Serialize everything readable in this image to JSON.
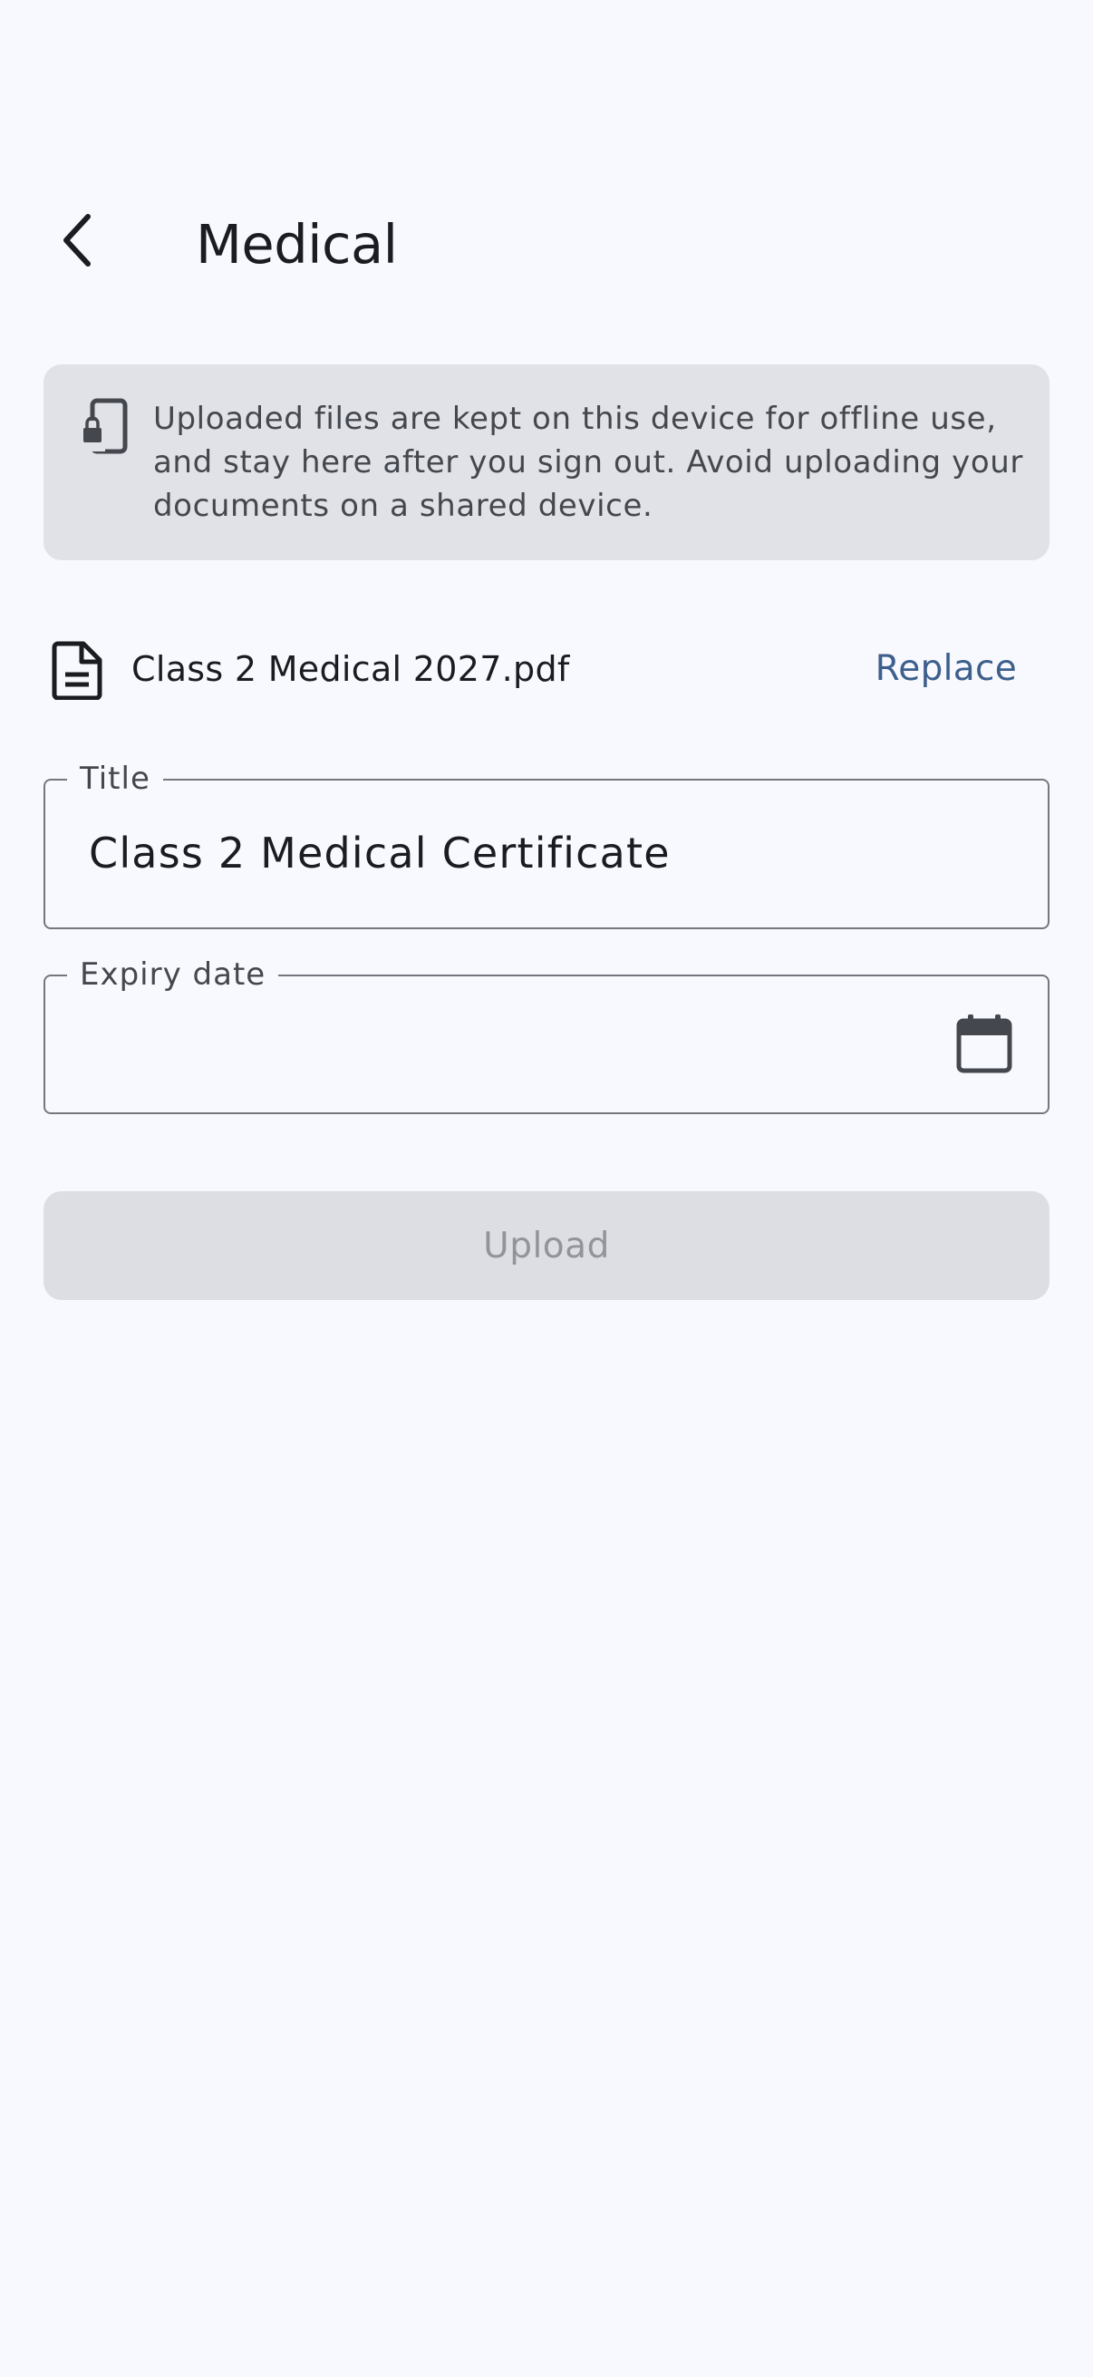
{
  "header": {
    "title": "Medical",
    "back_icon": "chevron-left-icon"
  },
  "info_banner": {
    "icon": "lock-device-icon",
    "text": "Uploaded files are kept on this device for offline use, and stay here after you sign out. Avoid uploading your documents on a shared device."
  },
  "file": {
    "icon": "document-icon",
    "name": "Class 2 Medical 2027.pdf",
    "replace_label": "Replace"
  },
  "form": {
    "title_label": "Title",
    "title_value": "Class 2 Medical Certificate",
    "expiry_label": "Expiry date",
    "expiry_value": "",
    "calendar_icon": "calendar-icon"
  },
  "actions": {
    "upload_label": "Upload",
    "upload_enabled": false
  },
  "colors": {
    "background": "#f8f9fe",
    "banner_background": "#e1e2e7",
    "accent": "#3d5f8c",
    "outline": "#74777f",
    "disabled_background": "#dddee3",
    "disabled_text": "#939499"
  }
}
